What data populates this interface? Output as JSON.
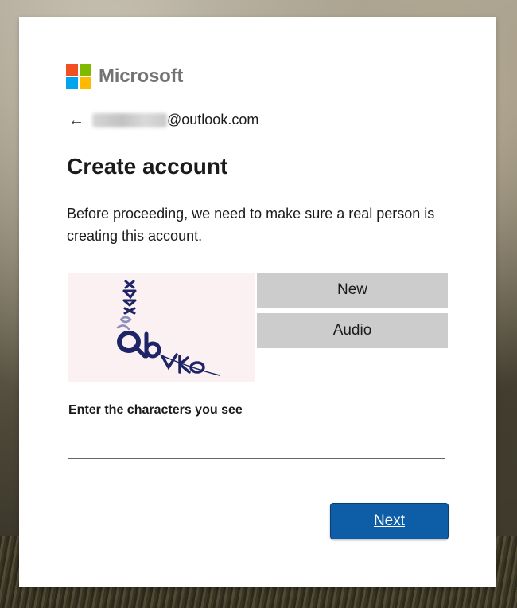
{
  "brand": {
    "name": "Microsoft",
    "logo_colors": [
      "#f25022",
      "#7fba00",
      "#00a4ef",
      "#ffb900"
    ]
  },
  "identity": {
    "back_icon": "left-arrow-icon",
    "email_visible": "@outlook.com"
  },
  "page": {
    "title": "Create account",
    "description": "Before proceeding, we need to make sure a real person is creating this account."
  },
  "captcha": {
    "new_label": "New",
    "audio_label": "Audio",
    "input_label": "Enter the characters you see",
    "input_value": "",
    "image_text": "MAX8QbVKo"
  },
  "actions": {
    "next_label": "Next"
  },
  "colors": {
    "primary": "#0d5ea6",
    "captcha_ink": "#1e2466",
    "captcha_bg": "#fbf1f3",
    "secondary_button": "#cccccc"
  }
}
